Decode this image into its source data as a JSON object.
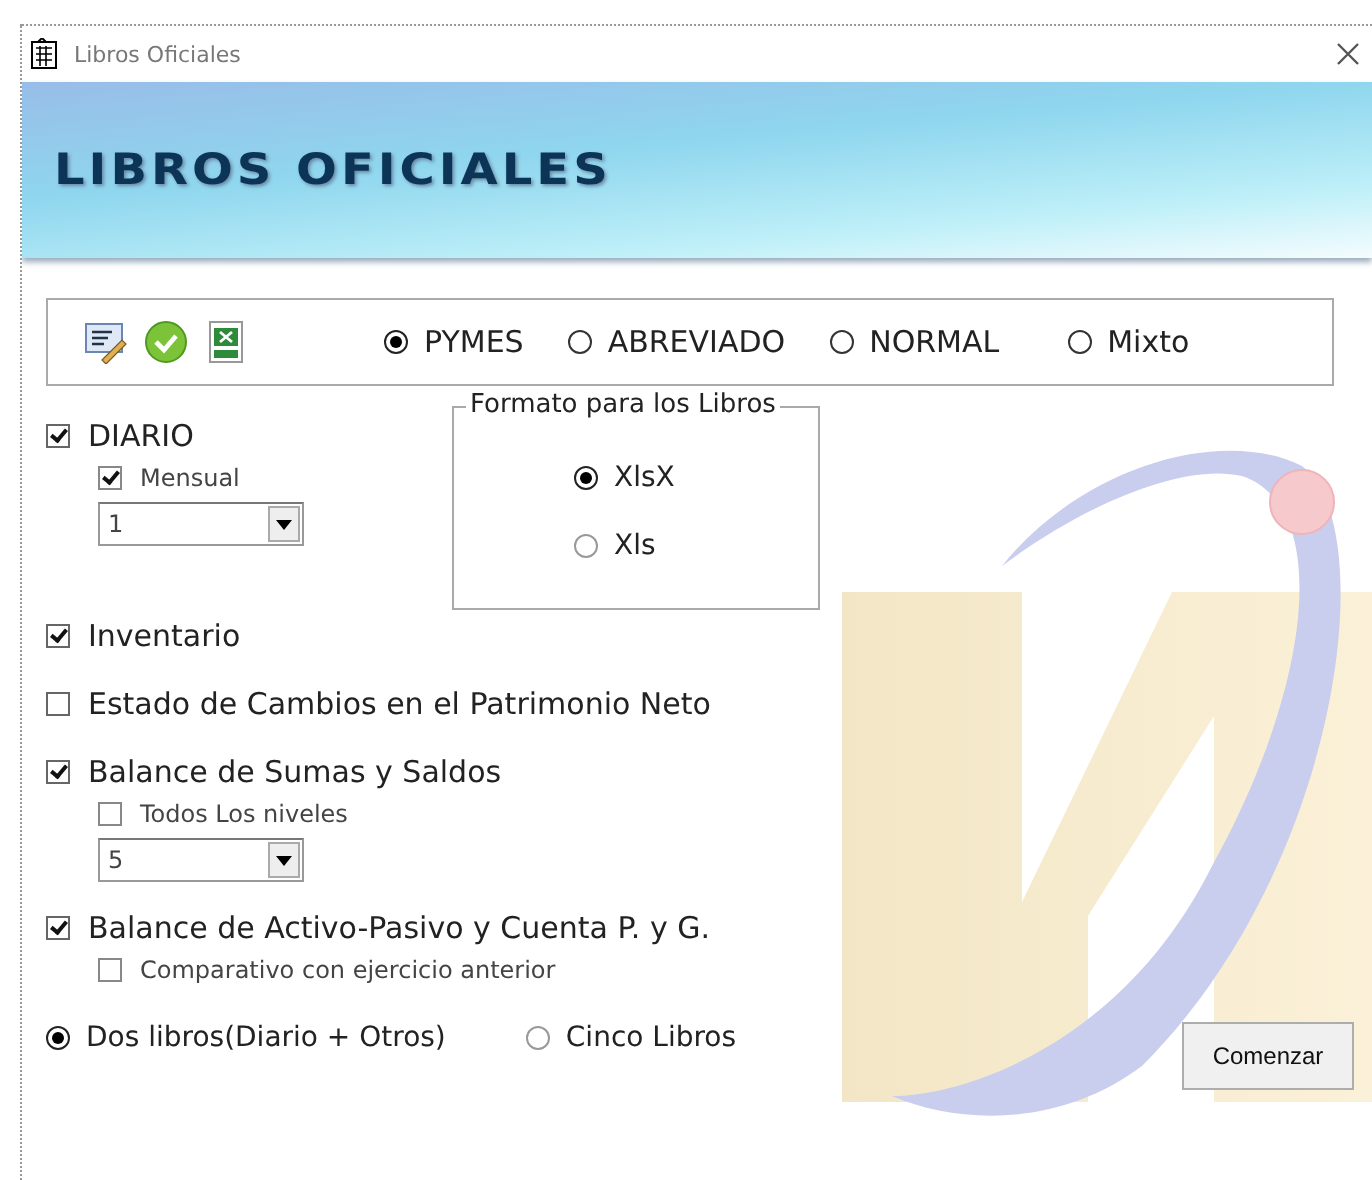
{
  "window": {
    "title": "Libros Oficiales"
  },
  "banner": {
    "title": "LIBROS OFICIALES"
  },
  "report_types": [
    {
      "label": "PYMES",
      "selected": true
    },
    {
      "label": "ABREVIADO",
      "selected": false
    },
    {
      "label": "NORMAL",
      "selected": false
    },
    {
      "label": "Mixto",
      "selected": false
    }
  ],
  "books": [
    {
      "label": "DIARIO",
      "checked": true,
      "options": [
        {
          "kind": "checkbox",
          "label": "Mensual",
          "checked": true
        },
        {
          "kind": "dropdown",
          "value": "1"
        }
      ]
    },
    {
      "label": "Inventario",
      "checked": true
    },
    {
      "label": "Estado de Cambios en el Patrimonio Neto",
      "checked": false
    },
    {
      "label": "Balance de Sumas y Saldos",
      "checked": true,
      "options": [
        {
          "kind": "checkbox",
          "label": "Todos Los niveles",
          "checked": false
        },
        {
          "kind": "dropdown",
          "value": "5"
        }
      ]
    },
    {
      "label": "Balance de Activo-Pasivo y Cuenta P. y G.",
      "checked": true,
      "options": [
        {
          "kind": "checkbox",
          "label": "Comparativo con ejercicio anterior",
          "checked": false
        }
      ]
    }
  ],
  "format_group": {
    "title": "Formato para los Libros",
    "options": [
      {
        "label": "XlsX",
        "selected": true
      },
      {
        "label": "Xls",
        "selected": false
      }
    ]
  },
  "output_modes": [
    {
      "label": "Dos libros(Diario + Otros)",
      "selected": true
    },
    {
      "label": "Cinco Libros",
      "selected": false
    }
  ],
  "start_button": {
    "label": "Comenzar"
  }
}
